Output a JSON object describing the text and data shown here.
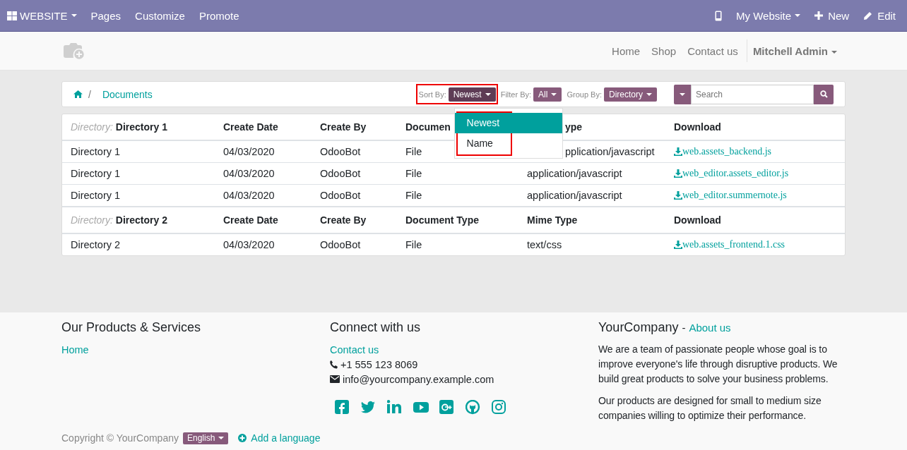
{
  "topbar": {
    "app_menu": "WEBSITE",
    "items": [
      "Pages",
      "Customize",
      "Promote"
    ],
    "right": [
      {
        "kind": "device"
      },
      {
        "kind": "dropdown",
        "label": "My Website"
      },
      {
        "kind": "new",
        "label": "New"
      },
      {
        "kind": "edit",
        "label": "Edit"
      }
    ]
  },
  "header": {
    "nav": [
      "Home",
      "Shop",
      "Contact us"
    ],
    "user": "Mitchell Admin"
  },
  "breadcrumb": {
    "separator": "/",
    "current": "Documents"
  },
  "controls": [
    {
      "label": "Sort By:",
      "value": "Newest",
      "open": true,
      "highlighted": true
    },
    {
      "label": "Filter By:",
      "value": "All",
      "open": false,
      "highlighted": false
    },
    {
      "label": "Group By:",
      "value": "Directory",
      "open": false,
      "highlighted": false
    }
  ],
  "sort_menu": {
    "highlighted": true,
    "items": [
      {
        "label": "Newest",
        "selected": true
      },
      {
        "label": "Name",
        "selected": false
      }
    ]
  },
  "search": {
    "placeholder": "Search"
  },
  "groups": [
    {
      "columns": [
        {
          "prefix": "Directory:",
          "label": "Directory 1"
        },
        {
          "label": "Create Date"
        },
        {
          "label": "Create By"
        },
        {
          "label": "Documen"
        },
        {
          "label": "ype",
          "partial": true
        },
        {
          "label": "Download"
        }
      ],
      "rows": [
        {
          "cells": [
            {
              "text": "Directory 1"
            },
            {
              "text": "04/03/2020"
            },
            {
              "text": "OdooBot"
            },
            {
              "text": "File"
            },
            {
              "text": "pplication/javascript",
              "partial": true
            }
          ],
          "download": "web.assets_backend.js"
        },
        {
          "cells": [
            {
              "text": "Directory 1"
            },
            {
              "text": "04/03/2020"
            },
            {
              "text": "OdooBot"
            },
            {
              "text": "File"
            },
            {
              "text": "application/javascript"
            }
          ],
          "download": "web_editor.assets_editor.js"
        },
        {
          "cells": [
            {
              "text": "Directory 1"
            },
            {
              "text": "04/03/2020"
            },
            {
              "text": "OdooBot"
            },
            {
              "text": "File"
            },
            {
              "text": "application/javascript"
            }
          ],
          "download": "web_editor.summernote.js"
        }
      ]
    },
    {
      "columns": [
        {
          "prefix": "Directory:",
          "label": "Directory 2"
        },
        {
          "label": "Create Date"
        },
        {
          "label": "Create By"
        },
        {
          "label": "Document Type"
        },
        {
          "label": "Mime Type"
        },
        {
          "label": "Download"
        }
      ],
      "rows": [
        {
          "cells": [
            {
              "text": "Directory 2"
            },
            {
              "text": "04/03/2020"
            },
            {
              "text": "OdooBot"
            },
            {
              "text": "File"
            },
            {
              "text": "text/css"
            }
          ],
          "download": "web.assets_frontend.1.css"
        }
      ]
    }
  ],
  "footer": {
    "products": {
      "title": "Our Products & Services",
      "links": [
        "Home"
      ]
    },
    "connect": {
      "title": "Connect with us",
      "link": "Contact us",
      "phone": "+1 555 123 8069",
      "email": "info@yourcompany.example.com",
      "social": [
        {
          "kind": "facebook"
        },
        {
          "kind": "twitter"
        },
        {
          "kind": "linkedin"
        },
        {
          "kind": "youtube"
        },
        {
          "kind": "googleplus"
        },
        {
          "kind": "github"
        },
        {
          "kind": "instagram"
        }
      ]
    },
    "about": {
      "company": "YourCompany",
      "separator": "-",
      "link": "About us",
      "paragraphs": [
        "We are a team of passionate people whose goal is to improve everyone's life through disruptive products. We build great products to solve your business problems.",
        "Our products are designed for small to medium size companies willing to optimize their performance."
      ]
    },
    "copyright": "Copyright © YourCompany",
    "language": "English",
    "add_language": "Add a language"
  }
}
